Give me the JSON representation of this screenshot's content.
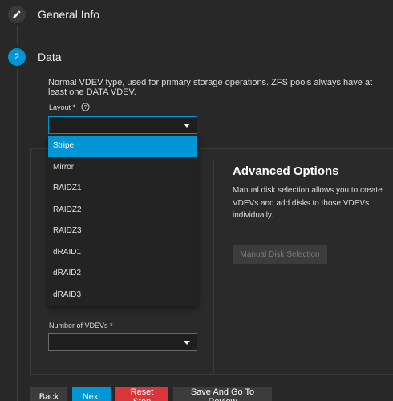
{
  "steps": [
    {
      "label": "General Info",
      "icon": "pencil-icon"
    },
    {
      "number": "2",
      "label": "Data"
    }
  ],
  "data_step": {
    "description": "Normal VDEV type, used for primary storage operations. ZFS pools always have at least one DATA VDEV.",
    "layout_label": "Layout *",
    "layout_value": "",
    "layout_options": [
      "Stripe",
      "Mirror",
      "RAIDZ1",
      "RAIDZ2",
      "RAIDZ3",
      "dRAID1",
      "dRAID2",
      "dRAID3"
    ],
    "highlighted_option": "Stripe",
    "vdevs_label": "Number of VDEVs *",
    "vdevs_value": ""
  },
  "advanced": {
    "title": "Advanced Options",
    "text": "Manual disk selection allows you to create VDEVs and add disks to those VDEVs individually.",
    "button": "Manual Disk Selection"
  },
  "buttons": {
    "back": "Back",
    "next": "Next",
    "reset": "Reset Step",
    "save": "Save And Go To Review"
  },
  "colors": {
    "accent": "#0095d5",
    "danger": "#d9353b",
    "background": "#282828"
  }
}
